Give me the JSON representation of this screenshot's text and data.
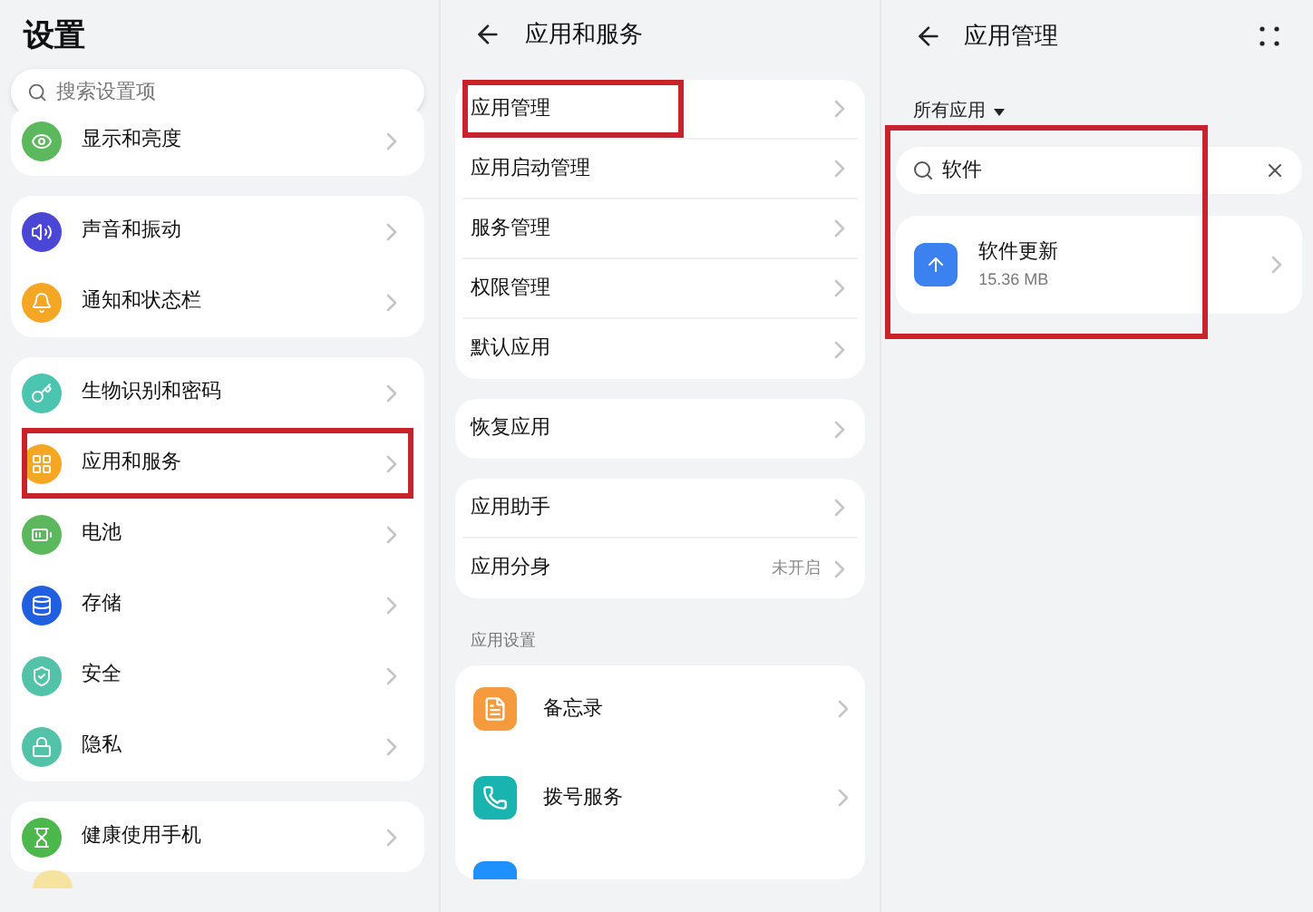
{
  "settings": {
    "title": "设置",
    "search": {
      "placeholder": "搜索设置项"
    },
    "groups": [
      {
        "items": [
          {
            "label": "显示和亮度",
            "highlighted": false
          }
        ]
      },
      {
        "items": [
          {
            "label": "声音和振动",
            "highlighted": false
          },
          {
            "label": "通知和状态栏",
            "highlighted": false
          }
        ]
      },
      {
        "items": [
          {
            "label": "生物识别和密码",
            "highlighted": false
          },
          {
            "label": "应用和服务",
            "highlighted": true
          },
          {
            "label": "电池",
            "highlighted": false
          },
          {
            "label": "存储",
            "highlighted": false
          },
          {
            "label": "安全",
            "highlighted": false
          },
          {
            "label": "隐私",
            "highlighted": false
          }
        ]
      },
      {
        "items": [
          {
            "label": "健康使用手机",
            "highlighted": false
          }
        ]
      }
    ]
  },
  "apps_services": {
    "title": "应用和服务",
    "groups": [
      {
        "items": [
          {
            "label": "应用管理",
            "highlighted": true
          },
          {
            "label": "应用启动管理",
            "highlighted": false
          },
          {
            "label": "服务管理",
            "highlighted": false
          },
          {
            "label": "权限管理",
            "highlighted": false
          },
          {
            "label": "默认应用",
            "highlighted": false
          }
        ]
      },
      {
        "items": [
          {
            "label": "恢复应用",
            "highlighted": false
          }
        ]
      },
      {
        "items": [
          {
            "label": "应用助手",
            "highlighted": false
          },
          {
            "label": "应用分身",
            "value": "未开启",
            "highlighted": false
          }
        ]
      }
    ],
    "section": {
      "title": "应用设置",
      "items": [
        {
          "label": "备忘录"
        },
        {
          "label": "拨号服务"
        }
      ]
    }
  },
  "app_management": {
    "title": "应用管理",
    "filter": "所有应用",
    "search": {
      "value": "软件"
    },
    "highlighted": true,
    "results": [
      {
        "name": "软件更新",
        "size": "15.36 MB"
      }
    ]
  }
}
